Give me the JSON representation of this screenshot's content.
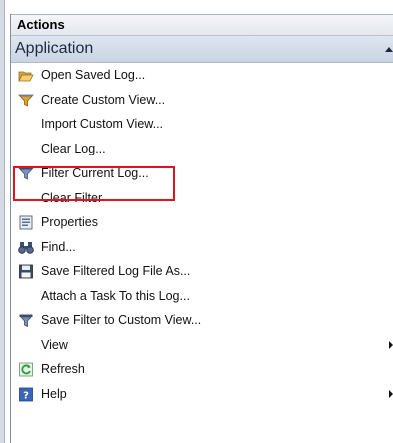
{
  "actions_pane": {
    "title": "Actions",
    "section": {
      "title": "Application",
      "collapse_icon": "chevron-up-icon"
    },
    "items": [
      {
        "label": "Open Saved Log...",
        "icon": "folder-open-icon"
      },
      {
        "label": "Create Custom View...",
        "icon": "filter-icon"
      },
      {
        "label": "Import Custom View...",
        "icon": ""
      },
      {
        "label": "Clear Log...",
        "icon": ""
      },
      {
        "label": "Filter Current Log...",
        "icon": "filter-icon",
        "highlighted": true
      },
      {
        "label": "Clear Filter",
        "icon": ""
      },
      {
        "label": "Properties",
        "icon": "properties-icon"
      },
      {
        "label": "Find...",
        "icon": "binoculars-icon"
      },
      {
        "label": "Save Filtered Log File As...",
        "icon": "save-icon"
      },
      {
        "label": "Attach a Task To this Log...",
        "icon": ""
      },
      {
        "label": "Save Filter to Custom View...",
        "icon": "save-filter-icon"
      },
      {
        "label": "View",
        "icon": "",
        "has_submenu": true
      },
      {
        "label": "Refresh",
        "icon": "refresh-icon"
      },
      {
        "label": "Help",
        "icon": "help-icon",
        "has_submenu": true
      }
    ]
  },
  "colors": {
    "highlight_border": "#e0141e",
    "section_header_bg": "#c9d4e3",
    "filter_icon": "#5a7fb5",
    "refresh_icon": "#2f9d3a",
    "help_icon": "#3a64b8"
  }
}
